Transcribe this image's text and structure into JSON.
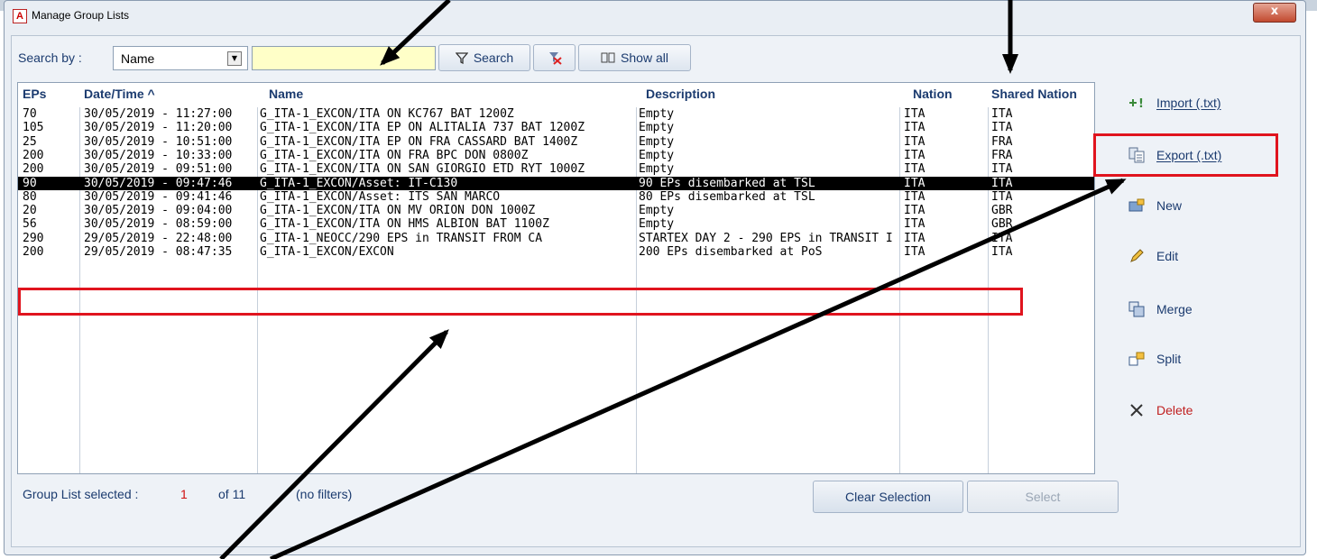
{
  "window": {
    "title": "Manage Group Lists",
    "app_icon": "A",
    "close": "x"
  },
  "toolbar": {
    "search_by_label": "Search by :",
    "search_field": "Name",
    "search_value": "",
    "search_button": "Search",
    "clear_icon": "clear-filter-icon",
    "show_all_button": "Show all"
  },
  "table": {
    "columns": [
      "EPs",
      "Date/Time ^",
      "Name",
      "Description",
      "Nation",
      "Shared Nation"
    ],
    "rows": [
      {
        "eps": "70",
        "datetime": "30/05/2019 - 11:27:00",
        "name": "G_ITA-1_EXCON/ITA ON KC767 BAT 1200Z",
        "description": "Empty",
        "nation": "ITA",
        "shared": "ITA"
      },
      {
        "eps": "105",
        "datetime": "30/05/2019 - 11:20:00",
        "name": "G_ITA-1_EXCON/ITA EP ON ALITALIA 737 BAT 1200Z",
        "description": "Empty",
        "nation": "ITA",
        "shared": "ITA"
      },
      {
        "eps": "25",
        "datetime": "30/05/2019 - 10:51:00",
        "name": "G_ITA-1_EXCON/ITA EP ON FRA CASSARD BAT 1400Z",
        "description": "Empty",
        "nation": "ITA",
        "shared": "FRA"
      },
      {
        "eps": "200",
        "datetime": "30/05/2019 - 10:33:00",
        "name": "G_ITA-1_EXCON/ITA ON FRA BPC DON 0800Z",
        "description": "Empty",
        "nation": "ITA",
        "shared": "FRA"
      },
      {
        "eps": "200",
        "datetime": "30/05/2019 - 09:51:00",
        "name": "G_ITA-1_EXCON/ITA ON SAN GIORGIO ETD RYT 1000Z",
        "description": "Empty",
        "nation": "ITA",
        "shared": "ITA"
      },
      {
        "eps": "90",
        "datetime": "30/05/2019 - 09:47:46",
        "name": "G_ITA-1_EXCON/Asset: IT-C130",
        "description": "90 EPs disembarked at TSL",
        "nation": "ITA",
        "shared": "ITA",
        "selected": true
      },
      {
        "eps": "80",
        "datetime": "30/05/2019 - 09:41:46",
        "name": "G_ITA-1_EXCON/Asset: ITS SAN MARCO",
        "description": "80 EPs disembarked at TSL",
        "nation": "ITA",
        "shared": "ITA"
      },
      {
        "eps": "20",
        "datetime": "30/05/2019 - 09:04:00",
        "name": "G_ITA-1_EXCON/ITA ON MV ORION DON 1000Z",
        "description": "Empty",
        "nation": "ITA",
        "shared": "GBR"
      },
      {
        "eps": "56",
        "datetime": "30/05/2019 - 08:59:00",
        "name": "G_ITA-1_EXCON/ITA ON HMS ALBION BAT 1100Z",
        "description": "Empty",
        "nation": "ITA",
        "shared": "GBR"
      },
      {
        "eps": "290",
        "datetime": "29/05/2019 - 22:48:00",
        "name": "G_ITA-1_NEOCC/290 EPS in TRANSIT FROM CA",
        "description": "STARTEX DAY 2 - 290 EPS in TRANSIT I",
        "nation": "ITA",
        "shared": "ITA"
      },
      {
        "eps": "200",
        "datetime": "29/05/2019 - 08:47:35",
        "name": "G_ITA-1_EXCON/EXCON",
        "description": "200 EPs disembarked at PoS",
        "nation": "ITA",
        "shared": "ITA"
      }
    ]
  },
  "status": {
    "selected_label": "Group List selected :",
    "selected_count": "1",
    "of_total": "of 11",
    "filters": "(no filters)"
  },
  "buttons": {
    "clear_selection": "Clear Selection",
    "select": "Select"
  },
  "side_actions": [
    {
      "label": "Import (.txt)",
      "icon": "import-icon"
    },
    {
      "label": "Export (.txt)",
      "icon": "export-icon"
    },
    {
      "label": "New",
      "icon": "new-icon"
    },
    {
      "label": "Edit",
      "icon": "pencil-icon"
    },
    {
      "label": "Merge",
      "icon": "merge-icon"
    },
    {
      "label": "Split",
      "icon": "split-icon"
    },
    {
      "label": "Delete",
      "icon": "delete-icon"
    }
  ],
  "colors": {
    "annotation_red": "#e0141e",
    "header_text": "#1b3b6f",
    "search_bg": "#ffffc8",
    "delete_text": "#c02020"
  }
}
